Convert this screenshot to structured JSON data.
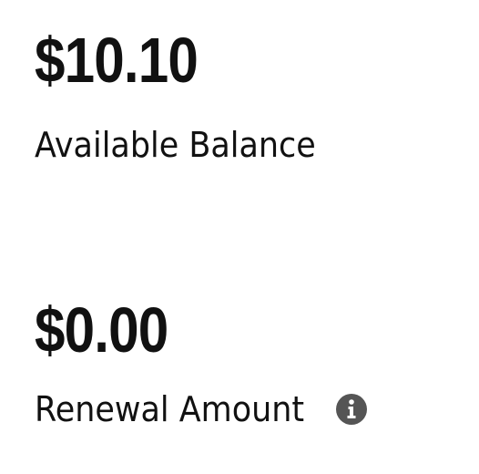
{
  "balance": {
    "amount": "$10.10",
    "label": "Available Balance"
  },
  "renewal": {
    "amount": "$0.00",
    "label": "Renewal Amount",
    "info_icon": "info-icon"
  },
  "colors": {
    "text": "#111111",
    "icon": "#555555"
  }
}
